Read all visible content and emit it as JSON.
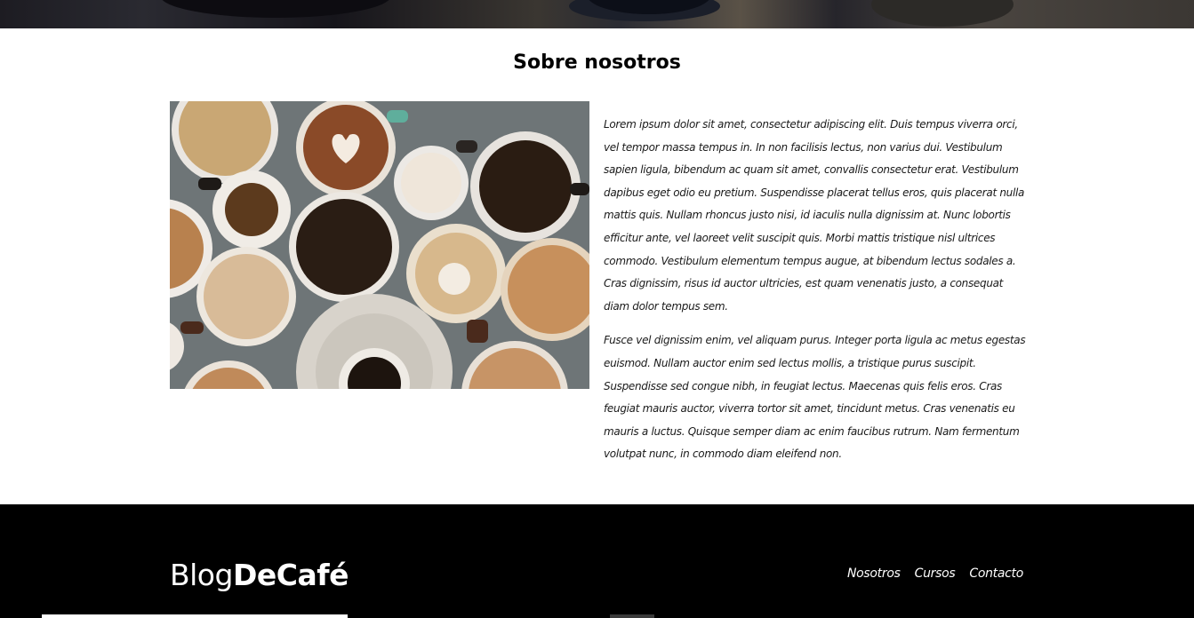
{
  "about": {
    "title": "Sobre nosotros",
    "image_alt": "cups of coffee on a table",
    "paragraphs": [
      "Lorem ipsum dolor sit amet, consectetur adipiscing elit. Duis tempus viverra orci, vel tempor massa tempus in. In non facilisis lectus, non varius dui. Vestibulum sapien ligula, bibendum ac quam sit amet, convallis consectetur erat. Vestibulum dapibus eget odio eu pretium. Suspendisse placerat tellus eros, quis placerat nulla mattis quis. Nullam rhoncus justo nisi, id iaculis nulla dignissim at. Nunc lobortis efficitur ante, vel laoreet velit suscipit quis. Morbi mattis tristique nisl ultrices commodo. Vestibulum elementum tempus augue, at bibendum lectus sodales a. Cras dignissim, risus id auctor ultricies, est quam venenatis justo, a consequat diam dolor tempus sem.",
      "Fusce vel dignissim enim, vel aliquam purus. Integer porta ligula ac metus egestas euismod. Nullam auctor enim sed lectus mollis, a tristique purus suscipit. Suspendisse sed congue nibh, in feugiat lectus. Maecenas quis felis eros. Cras feugiat mauris auctor, viverra tortor sit amet, tincidunt metus. Cras venenatis eu mauris a luctus. Quisque semper diam ac enim faucibus rutrum. Nam fermentum volutpat nunc, in commodo diam eleifend non."
    ]
  },
  "footer": {
    "logo_light": "Blog",
    "logo_bold": "DeCafé",
    "nav": [
      "Nosotros",
      "Cursos",
      "Contacto"
    ]
  },
  "colors": {
    "footer_bg": "#000000",
    "text": "#1a1a1a"
  }
}
